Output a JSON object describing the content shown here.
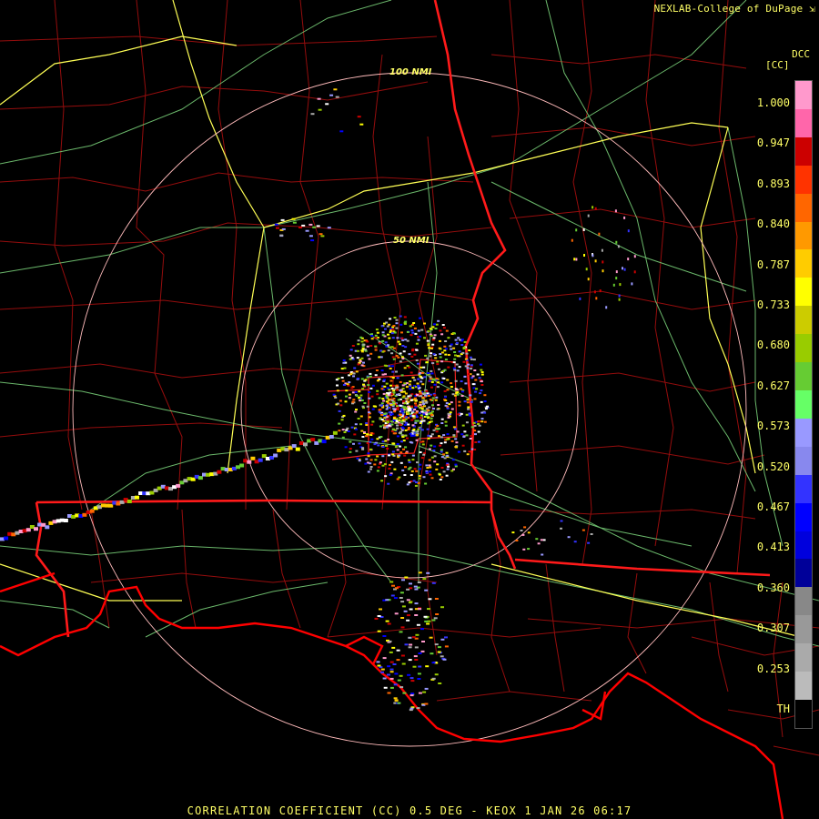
{
  "header": {
    "credit": "NEXLAB-College of DuPage",
    "credit_mark": "⇲"
  },
  "legend": {
    "product_code": "DCC",
    "unit_label": "[CC]",
    "ticks": [
      "1.000",
      "0.947",
      "0.893",
      "0.840",
      "0.787",
      "0.733",
      "0.680",
      "0.627",
      "0.573",
      "0.520",
      "0.467",
      "0.413",
      "0.360",
      "0.307",
      "0.253",
      "TH"
    ],
    "colors": [
      "#ff99cc",
      "#ff66aa",
      "#cc0000",
      "#ff3300",
      "#ff6600",
      "#ff9900",
      "#ffcc00",
      "#ffff00",
      "#cccc00",
      "#99cc00",
      "#66cc33",
      "#66ff66",
      "#9999ff",
      "#8888ee",
      "#3333ff",
      "#0000ff",
      "#0000dd",
      "#000099",
      "#888888",
      "#999999",
      "#aaaaaa",
      "#bbbbbb"
    ]
  },
  "map": {
    "range_rings": [
      {
        "label": "100 NMI"
      },
      {
        "label": "50 NMI"
      }
    ],
    "colors": {
      "state_border": "#ff1a1a",
      "county": "#bb1111",
      "interstate": "#ffff55",
      "highway": "#88dd88",
      "ring": "#ffbbbb",
      "coast": "#ff0000"
    }
  },
  "footer": {
    "caption": "CORRELATION COEFFICIENT (CC) 0.5 DEG - KEOX 1 JAN 26 06:17"
  }
}
